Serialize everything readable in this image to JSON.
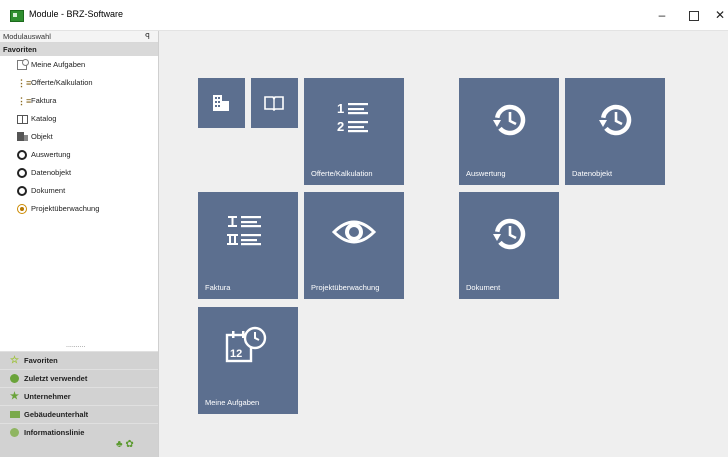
{
  "window": {
    "title": "Module - BRZ-Software",
    "minimize": "–",
    "close": "✕"
  },
  "sidebar": {
    "panel_title": "Modulauswahl",
    "pin": "ꟼ",
    "favorites_header": "Favoriten",
    "items": [
      {
        "label": "Meine Aufgaben",
        "icon": "tasks-icon"
      },
      {
        "label": "Offerte/Kalkulation",
        "icon": "numbered-list-icon"
      },
      {
        "label": "Faktura",
        "icon": "roman-list-icon"
      },
      {
        "label": "Katalog",
        "icon": "book-icon"
      },
      {
        "label": "Objekt",
        "icon": "building-icon"
      },
      {
        "label": "Auswertung",
        "icon": "history-icon"
      },
      {
        "label": "Datenobjekt",
        "icon": "history-icon"
      },
      {
        "label": "Dokument",
        "icon": "history-icon"
      },
      {
        "label": "Projektüberwachung",
        "icon": "eye-icon"
      }
    ],
    "grip": "..........",
    "bottom_nav": [
      {
        "label": "Favoriten",
        "icon": "star-icon"
      },
      {
        "label": "Zuletzt verwendet",
        "icon": "recent-icon"
      },
      {
        "label": "Unternehmer",
        "icon": "star-icon"
      },
      {
        "label": "Gebäudeunterhalt",
        "icon": "folder-icon"
      },
      {
        "label": "Informationslinie",
        "icon": "globe-icon"
      }
    ],
    "footer_icons": "♣ ✿"
  },
  "tiles": [
    {
      "label": "",
      "icon": "building-icon"
    },
    {
      "label": "",
      "icon": "book-icon"
    },
    {
      "label": "Offerte/Kalkulation",
      "icon": "numbered-list-icon"
    },
    {
      "label": "Auswertung",
      "icon": "history-icon"
    },
    {
      "label": "Datenobjekt",
      "icon": "history-icon"
    },
    {
      "label": "Faktura",
      "icon": "roman-list-icon"
    },
    {
      "label": "Projektüberwachung",
      "icon": "eye-icon"
    },
    {
      "label": "Dokument",
      "icon": "history-icon"
    },
    {
      "label": "Meine Aufgaben",
      "icon": "calendar-clock-icon"
    }
  ],
  "colors": {
    "tile": "#5c6f8f",
    "workspace": "#efefef",
    "sidebar_bottom": "#d2d2d2"
  }
}
